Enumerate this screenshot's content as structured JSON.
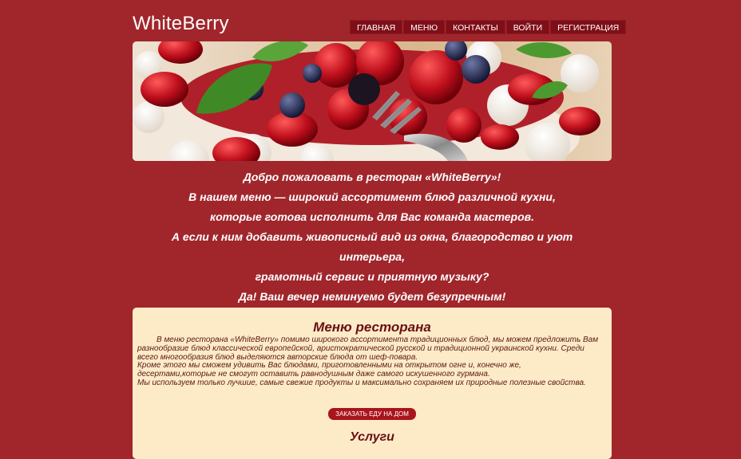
{
  "site": {
    "logo": "WhiteBerry"
  },
  "nav": {
    "items": [
      {
        "label": "ГЛАВНАЯ"
      },
      {
        "label": "МЕНЮ"
      },
      {
        "label": "КОНТАКТЫ"
      },
      {
        "label": "ВОЙТИ"
      },
      {
        "label": "РЕГИСТРАЦИЯ"
      }
    ]
  },
  "welcome": {
    "lines": [
      "Добро пожаловать в ресторан «WhiteBerry»!",
      "В нашем меню — широкий ассортимент блюд различной кухни,",
      "которые готова исполнить для Вас команда мастеров.",
      "А если к ним добавить живописный вид из окна, благородство и уют",
      "интерьера,",
      "грамотный сервис и приятную музыку?",
      "Да! Ваш вечер неминуемо будет безупречным!"
    ]
  },
  "menu_section": {
    "title": "Меню ресторана",
    "paragraphs": [
      "В меню ресторана «WhiteBerry» помимо широкого ассортимента традиционных блюд, мы можем предложить Вам разнообразие блюд классической европейской, аристократической русской и традиционной украинской кухни. Среди всего многообразия блюд выделяются авторские блюда от шеф-повара.",
      "Кроме этого мы сможем удивить Вас блюдами, приготовленными на открытом огне и, конечно же, десертами,которые не смогут оставить равнодушным даже самого искушенного гурмана.",
      "Мы используем только лучшие, самые свежие продукты и максимально сохраняем их природные полезные свойства."
    ],
    "order_button": "ЗАКАЗАТЬ ЕДУ НА ДОМ"
  },
  "services": {
    "title": "Услуги"
  }
}
